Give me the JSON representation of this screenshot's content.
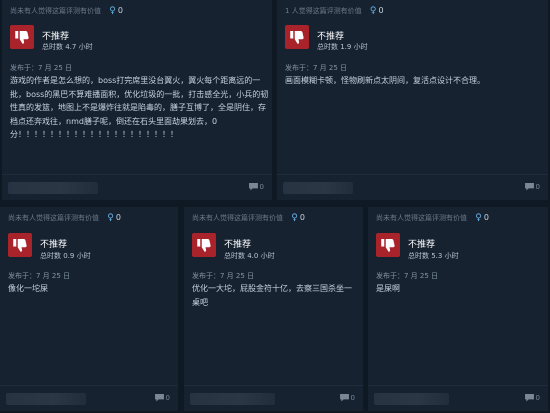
{
  "cards": [
    {
      "helpful": "尚未有人觉得这篇评测有价值",
      "awards": "0",
      "verdict": "不推荐",
      "hours": "总时数 4.7 小时",
      "posted": "发布于：7 月 25 日",
      "body": "游戏的作者是怎么想的，boss打完席里没台翼火，翼火每个距离远的一批，boss的黑巴不算难播面积，优化垃圾的一批，打击感全光，小兵的韧性真的发篮，地图上不是爆炸往就是陷毒的，膳子互博了，全是阴住，存档点还奔戏往，nmd膳子呢，倒还在石头里面劫果划去，0分！！！！！！！！！！！！！！！！！！！！",
      "comments": "0"
    },
    {
      "helpful": "1 人觉得这篇评测有价值",
      "awards": "0",
      "verdict": "不推荐",
      "hours": "总时数 1.9 小时",
      "posted": "发布于：7 月 25 日",
      "body": "画面模糊卡顿，怪物刷新点太阴间，复活点设计不合理。",
      "comments": "0"
    },
    {
      "helpful": "尚未有人觉得这篇评测有价值",
      "awards": "0",
      "verdict": "不推荐",
      "hours": "总时数 0.9 小时",
      "posted": "发布于：7 月 25 日",
      "body": "像化一坨屎",
      "comments": "0"
    },
    {
      "helpful": "尚未有人觉得这篇评测有价值",
      "awards": "0",
      "verdict": "不推荐",
      "hours": "总时数 4.0 小时",
      "posted": "发布于：7 月 25 日",
      "body": "优化一大坨，屁股金符十亿，去察三国杀坐一桌吧",
      "comments": "0"
    },
    {
      "helpful": "尚未有人觉得这篇评测有价值",
      "awards": "0",
      "verdict": "不推荐",
      "hours": "总时数 5.3 小时",
      "posted": "发布于：7 月 25 日",
      "body": "是屎啊",
      "comments": "0"
    }
  ]
}
